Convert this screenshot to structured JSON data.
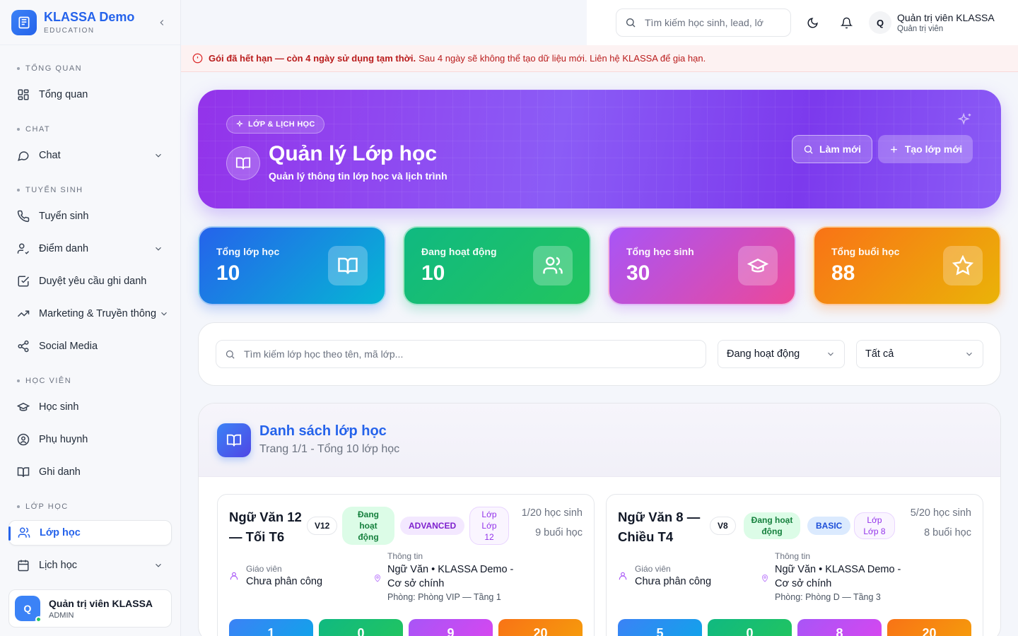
{
  "brand": {
    "name": "KLASSA Demo",
    "subtitle": "EDUCATION"
  },
  "sidebar": {
    "sections": [
      {
        "label": "TỔNG QUAN",
        "items": [
          {
            "label": "Tổng quan",
            "icon": "dashboard-icon"
          }
        ]
      },
      {
        "label": "CHAT",
        "items": [
          {
            "label": "Chat",
            "icon": "chat-icon"
          }
        ]
      },
      {
        "label": "TUYỂN SINH",
        "items": [
          {
            "label": "Tuyển sinh",
            "icon": "phone-icon"
          },
          {
            "label": "Điểm danh",
            "icon": "user-check-icon"
          },
          {
            "label": "Duyệt yêu cầu ghi danh",
            "icon": "checkbox-icon"
          },
          {
            "label": "Marketing & Truyền thông",
            "icon": "trending-up-icon"
          },
          {
            "label": "Social Media",
            "icon": "share-icon"
          }
        ]
      },
      {
        "label": "HỌC VIÊN",
        "items": [
          {
            "label": "Học sinh",
            "icon": "graduation-cap-icon"
          },
          {
            "label": "Phụ huynh",
            "icon": "user-circle-icon"
          },
          {
            "label": "Ghi danh",
            "icon": "book-open-icon"
          }
        ]
      },
      {
        "label": "LỚP HỌC",
        "items": [
          {
            "label": "Lớp học",
            "icon": "users-icon"
          },
          {
            "label": "Lịch học",
            "icon": "calendar-icon"
          }
        ]
      }
    ],
    "user": {
      "initial": "Q",
      "name": "Quản trị viên KLASSA",
      "role": "ADMIN"
    }
  },
  "topbar": {
    "search_placeholder": "Tìm kiếm học sinh, lead, lớ",
    "user": {
      "initial": "Q",
      "name": "Quản trị viên KLASSA",
      "role": "Quản trị viên"
    }
  },
  "alert": {
    "strong": "Gói đã hết hạn — còn 4 ngày sử dụng tạm thời.",
    "text": "Sau 4 ngày sẽ không thể tạo dữ liệu mới. Liên hệ KLASSA để gia hạn."
  },
  "hero": {
    "tag": "LỚP & LỊCH HỌC",
    "title": "Quản lý Lớp học",
    "subtitle": "Quản lý thông tin lớp học và lịch trình",
    "refresh_label": "Làm mới",
    "create_label": "Tạo lớp mới"
  },
  "stats": [
    {
      "label": "Tổng lớp học",
      "value": "10"
    },
    {
      "label": "Đang hoạt động",
      "value": "10"
    },
    {
      "label": "Tổng học sinh",
      "value": "30"
    },
    {
      "label": "Tổng buổi học",
      "value": "88"
    }
  ],
  "filters": {
    "search_placeholder": "Tìm kiếm lớp học theo tên, mã lớp...",
    "status_value": "Đang hoạt động",
    "level_value": "Tất cả"
  },
  "list": {
    "title": "Danh sách lớp học",
    "subtitle": "Trang 1/1 - Tổng 10 lớp học"
  },
  "classes": [
    {
      "name": "Ngữ Văn 12 — Tối T6",
      "code": "V12",
      "status": "Đang hoạt động",
      "level": "ADVANCED",
      "grade": "Lớp Lớp 12",
      "students": "1/20 học sinh",
      "sessions": "9 buổi học",
      "teacher_label": "Giáo viên",
      "teacher": "Chưa phân công",
      "info_label": "Thông tin",
      "info": "Ngữ Văn • KLASSA Demo - Cơ sở chính",
      "room": "Phòng: Phòng VIP — Tầng 1",
      "mini": [
        "1",
        "0",
        "9",
        "20"
      ]
    },
    {
      "name": "Ngữ Văn 8 — Chiều T4",
      "code": "V8",
      "status": "Đang hoạt động",
      "level": "BASIC",
      "grade": "Lớp Lớp 8",
      "students": "5/20 học sinh",
      "sessions": "8 buổi học",
      "teacher_label": "Giáo viên",
      "teacher": "Chưa phân công",
      "info_label": "Thông tin",
      "info": "Ngữ Văn • KLASSA Demo - Cơ sở chính",
      "room": "Phòng: Phòng D — Tầng 3",
      "mini": [
        "5",
        "0",
        "8",
        "20"
      ]
    }
  ]
}
